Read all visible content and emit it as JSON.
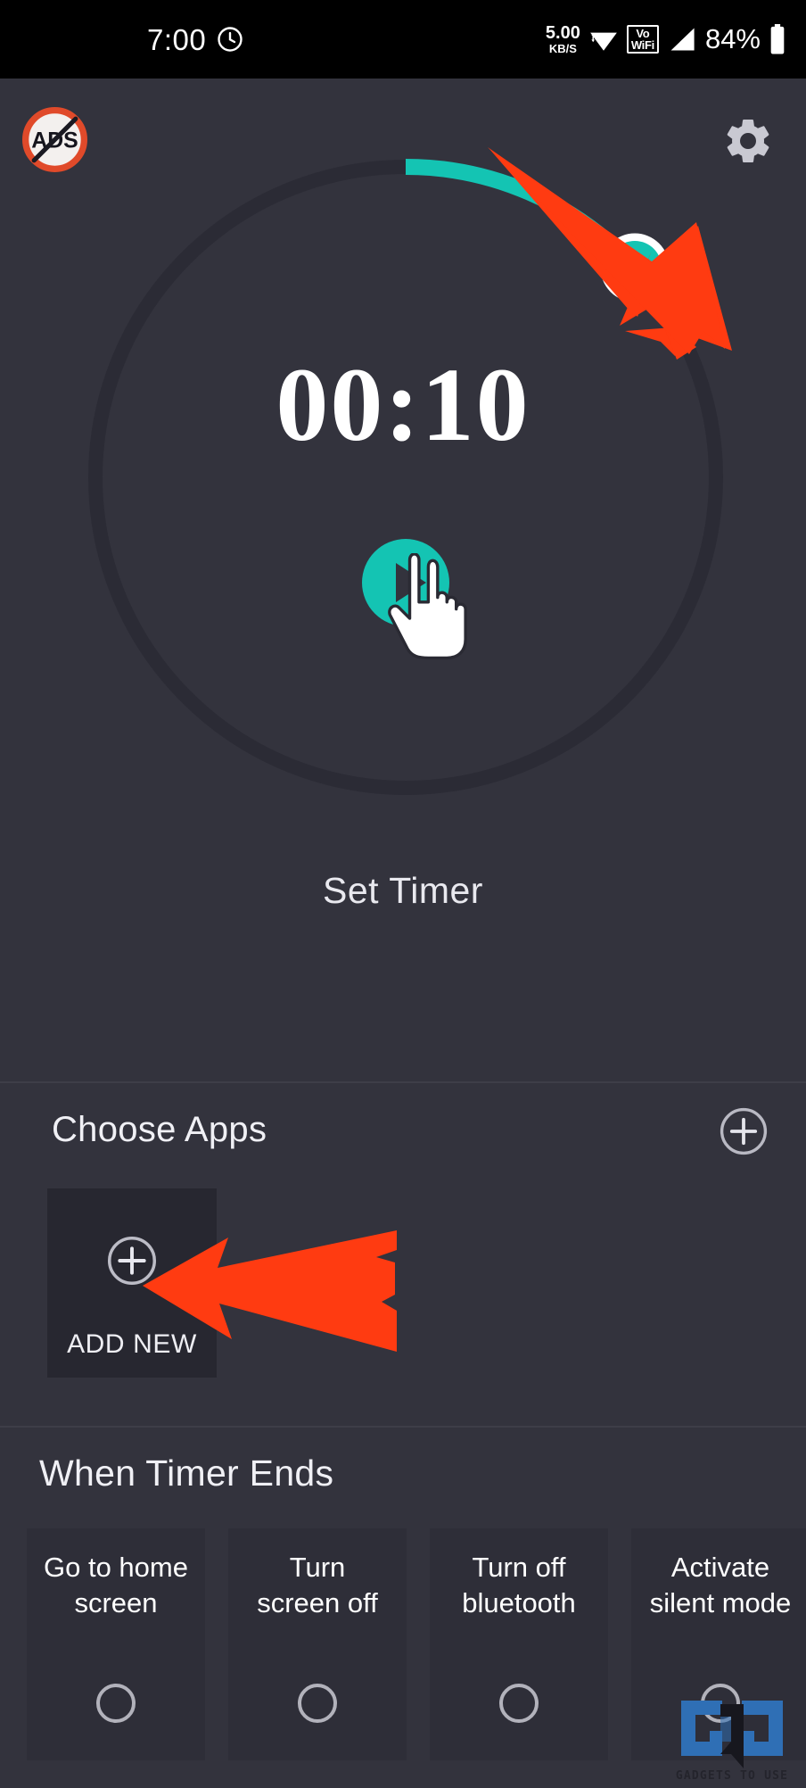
{
  "status_bar": {
    "time": "7:00",
    "clock_icon": "clock-icon",
    "net_speed_value": "5.00",
    "net_speed_unit": "KB/S",
    "wifi_icon": "wifi-icon",
    "vowifi_line1": "Vo",
    "vowifi_line2": "WiFi",
    "signal_icon": "cellular-signal-icon",
    "battery_percent": "84%",
    "battery_icon": "battery-full-icon"
  },
  "top_bar": {
    "no_ads_label": "ADS",
    "no_ads_icon": "no-ads-icon",
    "settings_icon": "gear-icon"
  },
  "timer": {
    "display": "00:10",
    "label": "Set Timer",
    "play_icon": "play-icon",
    "hand_cursor_icon": "hand-pointer-icon",
    "progress_fraction": 0.125,
    "track_color": "#2b2b35",
    "progress_color": "#14c4b3",
    "knob_color": "#14c4b3",
    "knob_ring_color": "#ffffff"
  },
  "choose_apps": {
    "title": "Choose Apps",
    "add_icon": "plus-circle-icon",
    "tile": {
      "label": "ADD NEW",
      "icon": "plus-circle-icon"
    }
  },
  "when_timer_ends": {
    "title": "When Timer Ends",
    "options": [
      {
        "label": "Go to home\nscreen",
        "selected": false
      },
      {
        "label": "Turn\nscreen off",
        "selected": false
      },
      {
        "label": "Turn off\nbluetooth",
        "selected": false
      },
      {
        "label": "Activate\nsilent mode",
        "selected": false
      }
    ]
  },
  "annotations": {
    "arrow_color": "#ff3b11",
    "arrow_to_knob": "red-arrow-pointing-to-timer-knob",
    "arrow_to_add_new": "red-arrow-pointing-to-add-new-tile"
  },
  "watermark": {
    "text": "GADGETS TO USE",
    "color": "#2f6fb5"
  },
  "theme": {
    "background": "#33333d",
    "card_background": "#2e2e38",
    "tile_background": "#272730",
    "accent": "#14c4b3",
    "status_bar_background": "#000000"
  }
}
